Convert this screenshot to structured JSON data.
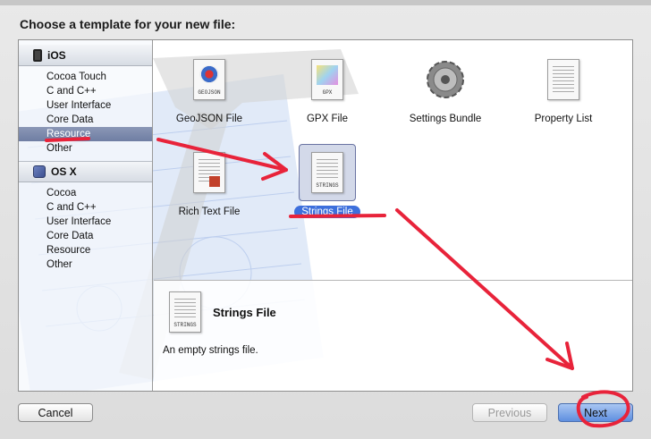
{
  "header": {
    "title": "Choose a template for your new file:"
  },
  "sidebar": {
    "sections": [
      {
        "title": "iOS",
        "icon": "iphone-icon",
        "items": [
          "Cocoa Touch",
          "C and C++",
          "User Interface",
          "Core Data",
          "Resource",
          "Other"
        ],
        "selected": "Resource"
      },
      {
        "title": "OS X",
        "icon": "mac-os-icon",
        "items": [
          "Cocoa",
          "C and C++",
          "User Interface",
          "Core Data",
          "Resource",
          "Other"
        ]
      }
    ]
  },
  "templates": {
    "geojson": {
      "label": "GeoJSON File",
      "tag": "GEOJSON"
    },
    "gpx": {
      "label": "GPX File",
      "tag": "GPX"
    },
    "settings": {
      "label": "Settings Bundle"
    },
    "plist": {
      "label": "Property List"
    },
    "rtf": {
      "label": "Rich Text File"
    },
    "strings": {
      "label": "Strings File",
      "tag": "STRINGS",
      "selected": true
    }
  },
  "details": {
    "title": "Strings File",
    "description": "An empty strings file.",
    "tag": "STRINGS"
  },
  "buttons": {
    "cancel": "Cancel",
    "previous": "Previous",
    "next": "Next"
  },
  "colors": {
    "annotation_red": "#e8233a",
    "selection_blue": "#3d6fdc",
    "sidebar_selected": "#7a87aa"
  }
}
